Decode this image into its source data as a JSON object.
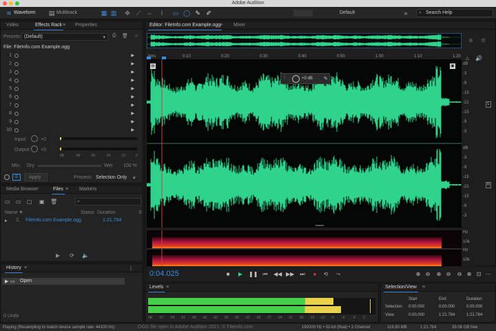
{
  "window": {
    "title": "Adobe Audition"
  },
  "toolbar": {
    "waveform_label": "Waveform",
    "multitrack_label": "Multitrack",
    "workspace_label": "Default",
    "search_placeholder": "Search Help"
  },
  "left_top": {
    "tabs": [
      "Video",
      "Effects Rack",
      "Properties"
    ],
    "presets_label": "Presets:",
    "presets_value": "(Default)",
    "file_label": "File: FileInfo.com Example.ogg",
    "rack_rows": [
      "1",
      "2",
      "3",
      "4",
      "5",
      "6",
      "7",
      "8",
      "9",
      "10"
    ],
    "input_label": "Input:",
    "output_label": "Output:",
    "input_value": "+0",
    "output_value": "+0",
    "mix_label": "Mix:",
    "dry_label": "Dry",
    "wet_label": "Wet",
    "mix_value": "100 %",
    "meter_ticks": [
      "dB",
      "-48",
      "-36",
      "-24",
      "-12",
      "0"
    ],
    "apply_label": "Apply",
    "process_label": "Process:",
    "process_value": "Selection Only"
  },
  "left_mid": {
    "tabs": [
      "Media Browser",
      "Files",
      "Markers"
    ],
    "columns": {
      "name": "Name",
      "status": "Status",
      "duration": "Duration",
      "s": "S"
    },
    "files": [
      {
        "name": "FileInfo.com Example.ogg",
        "duration": "1:21.784"
      }
    ]
  },
  "history": {
    "title": "History",
    "items": [
      "Open"
    ],
    "undo_label": "0 Undo"
  },
  "editor": {
    "tab_label": "Editor: FileInfo.com Example.ogg",
    "mixer_label": "Mixer",
    "ruler_labels": [
      "hms",
      "0:10",
      "0:20",
      "0:30",
      "0:40",
      "0:50",
      "1:00",
      "1:10",
      "1:20"
    ],
    "hud_value": "+0 dB",
    "db_top": [
      "dB",
      "-3",
      "-9",
      "-15",
      "-21",
      "-15",
      "-9",
      "-3"
    ],
    "db_bottom": [
      "dB",
      "-3",
      "-9",
      "-15",
      "-21",
      "-15",
      "-9",
      "-3"
    ],
    "channel_top": "L",
    "channel_bottom": "R",
    "hz_top": [
      "Hz",
      "10k"
    ],
    "hz_bottom": [
      "Hz",
      "10k"
    ],
    "time_display": "0:04.025"
  },
  "colors": {
    "waveform": "#2fd38c",
    "accent": "#3b8de0",
    "level_green": "#46d04a",
    "level_yellow": "#e9d04a"
  },
  "levels": {
    "title": "Levels",
    "scale": [
      "dB",
      "-57",
      "-54",
      "-51",
      "-48",
      "-45",
      "-42",
      "-39",
      "-36",
      "-33",
      "-30",
      "-27",
      "-24",
      "-21",
      "-18",
      "-15",
      "-12",
      "-9",
      "-6",
      "-3",
      "0"
    ],
    "left_fraction": 0.92,
    "right_fraction": 0.96
  },
  "selection_view": {
    "title": "Selection/View",
    "headers": [
      "Start",
      "End",
      "Duration"
    ],
    "rows": [
      {
        "label": "Selection",
        "start": "0:00.000",
        "end": "0:00.000",
        "duration": "0:00.000"
      },
      {
        "label": "View",
        "start": "0:00.000",
        "end": "1:21.784",
        "duration": "1:21.784"
      }
    ]
  },
  "status": {
    "left": "Playing (Resampling to match device sample rate: 44100 Hz)",
    "center": "OGG file open in Adobe Audition 2021. © FileInfo.com",
    "format": "192000 Hz • 32-bit (float) • 2 Channel",
    "size": "119.80 MB",
    "duration": "1:21.784",
    "free": "39.06 GB free"
  }
}
